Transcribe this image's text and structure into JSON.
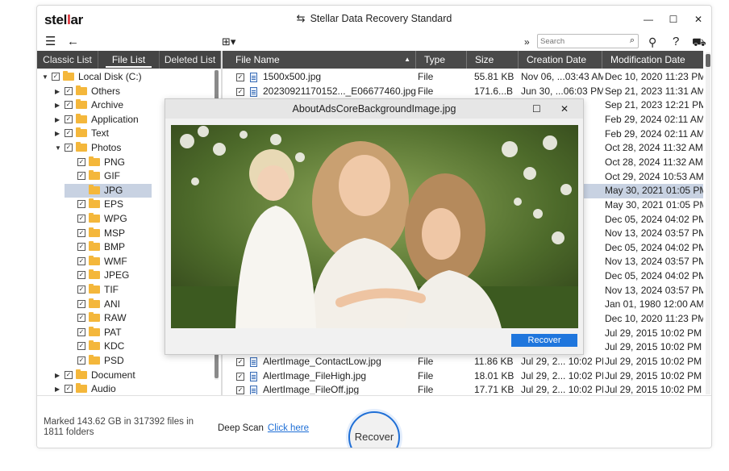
{
  "app": {
    "logo_pre": "stel",
    "logo_mark": "l",
    "logo_post": "ar",
    "title": "Stellar Data Recovery Standard"
  },
  "toolbar": {
    "search_placeholder": "Search"
  },
  "left_tabs": [
    "Classic List",
    "File List",
    "Deleted List"
  ],
  "tree": [
    {
      "label": "Local Disk (C:)",
      "level": 0,
      "caret": "▼"
    },
    {
      "label": "Others",
      "level": 1,
      "caret": "▶"
    },
    {
      "label": "Archive",
      "level": 1,
      "caret": "▶"
    },
    {
      "label": "Application",
      "level": 1,
      "caret": "▶"
    },
    {
      "label": "Text",
      "level": 1,
      "caret": "▶"
    },
    {
      "label": "Photos",
      "level": 1,
      "caret": "▼"
    },
    {
      "label": "PNG",
      "level": 2,
      "caret": ""
    },
    {
      "label": "GIF",
      "level": 2,
      "caret": ""
    },
    {
      "label": "JPG",
      "level": 2,
      "caret": "",
      "selected": true
    },
    {
      "label": "EPS",
      "level": 2,
      "caret": ""
    },
    {
      "label": "WPG",
      "level": 2,
      "caret": ""
    },
    {
      "label": "MSP",
      "level": 2,
      "caret": ""
    },
    {
      "label": "BMP",
      "level": 2,
      "caret": ""
    },
    {
      "label": "WMF",
      "level": 2,
      "caret": ""
    },
    {
      "label": "JPEG",
      "level": 2,
      "caret": ""
    },
    {
      "label": "TIF",
      "level": 2,
      "caret": ""
    },
    {
      "label": "ANI",
      "level": 2,
      "caret": ""
    },
    {
      "label": "RAW",
      "level": 2,
      "caret": ""
    },
    {
      "label": "PAT",
      "level": 2,
      "caret": ""
    },
    {
      "label": "KDC",
      "level": 2,
      "caret": ""
    },
    {
      "label": "PSD",
      "level": 2,
      "caret": ""
    },
    {
      "label": "Document",
      "level": 1,
      "caret": "▶"
    },
    {
      "label": "Audio",
      "level": 1,
      "caret": "▶"
    }
  ],
  "columns": [
    "File Name",
    "Type",
    "Size",
    "Creation Date",
    "Modification Date"
  ],
  "files": [
    {
      "name": "1500x500.jpg",
      "type": "File",
      "size": "55.81 KB",
      "created": "Nov 06, ...03:43 AM",
      "modified": "Dec 10, 2020 11:23 PM"
    },
    {
      "name": "20230921170152..._E06677460.jpg",
      "type": "File",
      "size": "171.6...B",
      "created": "Jun 30, ...06:03 PM",
      "modified": "Sep 21, 2023 11:31 AM"
    },
    {
      "name": "",
      "type": "",
      "size": "",
      "created": "PM",
      "modified": "Sep 21, 2023 12:21 PM"
    },
    {
      "name": "",
      "type": "",
      "size": "",
      "created": "PM",
      "modified": "Feb 29, 2024 02:11 AM"
    },
    {
      "name": "",
      "type": "",
      "size": "",
      "created": "PM",
      "modified": "Feb 29, 2024 02:11 AM"
    },
    {
      "name": "",
      "type": "",
      "size": "",
      "created": "AM",
      "modified": "Oct 28, 2024 11:32 AM"
    },
    {
      "name": "",
      "type": "",
      "size": "",
      "created": "AM",
      "modified": "Oct 28, 2024 11:32 AM"
    },
    {
      "name": "",
      "type": "",
      "size": "",
      "created": "AM",
      "modified": "Oct 29, 2024 10:53 AM"
    },
    {
      "name": "",
      "type": "",
      "size": "",
      "created": "PM",
      "modified": "May 30, 2021 01:05 PM",
      "selected": true
    },
    {
      "name": "",
      "type": "",
      "size": "",
      "created": "PM",
      "modified": "May 30, 2021 01:05 PM"
    },
    {
      "name": "",
      "type": "",
      "size": "",
      "created": "PM",
      "modified": "Dec 05, 2024 04:02 PM"
    },
    {
      "name": "",
      "type": "",
      "size": "",
      "created": "PM",
      "modified": "Nov 13, 2024 03:57 PM"
    },
    {
      "name": "",
      "type": "",
      "size": "",
      "created": "PM",
      "modified": "Dec 05, 2024 04:02 PM"
    },
    {
      "name": "",
      "type": "",
      "size": "",
      "created": "PM",
      "modified": "Nov 13, 2024 03:57 PM"
    },
    {
      "name": "",
      "type": "",
      "size": "",
      "created": "PM",
      "modified": "Dec 05, 2024 04:02 PM"
    },
    {
      "name": "",
      "type": "",
      "size": "",
      "created": "PM",
      "modified": "Nov 13, 2024 03:57 PM"
    },
    {
      "name": "",
      "type": "",
      "size": "",
      "created": "AM",
      "modified": "Jan 01, 1980 12:00 AM"
    },
    {
      "name": "",
      "type": "",
      "size": "",
      "created": "PM",
      "modified": "Dec 10, 2020 11:23 PM"
    },
    {
      "name": "",
      "type": "",
      "size": "",
      "created": "PM",
      "modified": "Jul 29, 2015 10:02 PM"
    },
    {
      "name": "",
      "type": "",
      "size": "",
      "created": "PM",
      "modified": "Jul 29, 2015 10:02 PM"
    },
    {
      "name": "AlertImage_ContactLow.jpg",
      "type": "File",
      "size": "11.86 KB",
      "created": "Jul 29, 2... 10:02 PM",
      "modified": "Jul 29, 2015 10:02 PM"
    },
    {
      "name": "AlertImage_FileHigh.jpg",
      "type": "File",
      "size": "18.01 KB",
      "created": "Jul 29, 2... 10:02 PM",
      "modified": "Jul 29, 2015 10:02 PM"
    },
    {
      "name": "AlertImage_FileOff.jpg",
      "type": "File",
      "size": "17.71 KB",
      "created": "Jul 29, 2... 10:02 PM",
      "modified": "Jul 29, 2015 10:02 PM"
    }
  ],
  "preview": {
    "title": "AboutAdsCoreBackgroundImage.jpg",
    "recover_label": "Recover"
  },
  "footer": {
    "status": "Marked 143.62 GB in 317392 files in 1811 folders",
    "deep_scan_label": "Deep Scan",
    "deep_scan_link": "Click here",
    "recover_label": "Recover"
  },
  "colors": {
    "accent": "#1f76dd",
    "brand_red": "#d81f26",
    "header_bg": "#4a4a4a",
    "selection": "#c8d2e2"
  }
}
